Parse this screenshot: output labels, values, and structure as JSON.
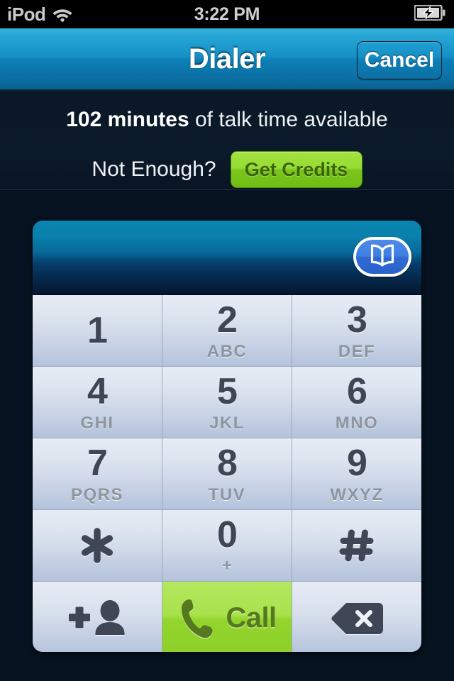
{
  "status_bar": {
    "carrier": "iPod",
    "wifi_icon": "wifi-icon",
    "time": "3:22 PM",
    "battery_icon": "battery-charging-icon"
  },
  "nav_bar": {
    "title": "Dialer",
    "cancel_label": "Cancel"
  },
  "credits_banner": {
    "talktime_amount": "102 minutes",
    "talktime_rest": " of talk time available",
    "not_enough_label": "Not Enough?",
    "get_credits_label": "Get Credits"
  },
  "dialer": {
    "number_value": "",
    "contacts_icon": "address-book-icon",
    "keys": [
      {
        "digit": "1",
        "letters": ""
      },
      {
        "digit": "2",
        "letters": "ABC"
      },
      {
        "digit": "3",
        "letters": "DEF"
      },
      {
        "digit": "4",
        "letters": "GHI"
      },
      {
        "digit": "5",
        "letters": "JKL"
      },
      {
        "digit": "6",
        "letters": "MNO"
      },
      {
        "digit": "7",
        "letters": "PQRS"
      },
      {
        "digit": "8",
        "letters": "TUV"
      },
      {
        "digit": "9",
        "letters": "WXYZ"
      },
      {
        "digit": "*",
        "letters": ""
      },
      {
        "digit": "0",
        "letters": "+"
      },
      {
        "digit": "#",
        "letters": ""
      }
    ],
    "add_contact_icon": "add-person-icon",
    "call_label": "Call",
    "call_icon": "phone-handset-icon",
    "backspace_icon": "backspace-delete-icon"
  },
  "colors": {
    "accent_green": "#93d52e",
    "nav_blue": "#0d7fb6",
    "display_blue": "#0a85b0",
    "key_face": "#d3dcea",
    "key_text": "#3f4656",
    "key_letters": "#8d959f",
    "background": "#0a1726"
  }
}
